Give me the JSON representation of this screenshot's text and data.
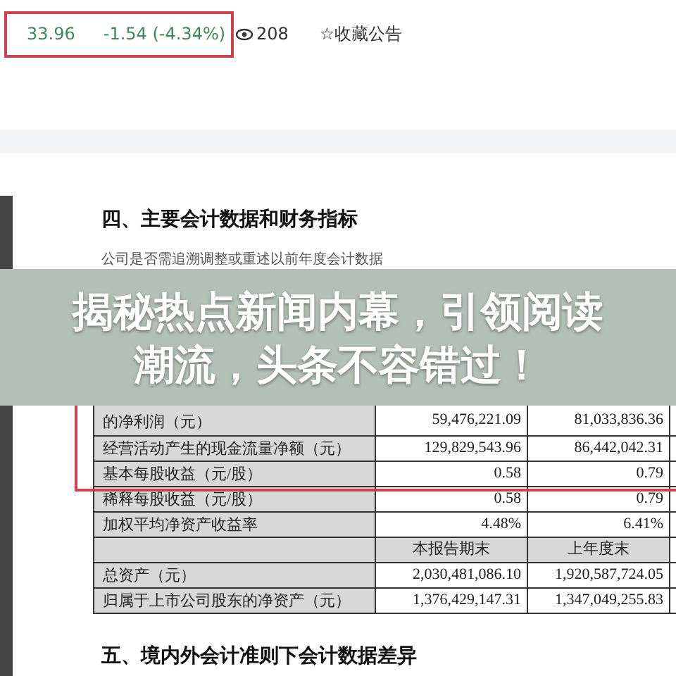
{
  "quote": {
    "price": "33.96",
    "change": "-1.54 (-4.34%)",
    "views": "208",
    "favorite": "☆收藏公告"
  },
  "document": {
    "section_heading": "四、主要会计数据和财务指标",
    "note": "公司是否需追溯调整或重述以前年度会计数据",
    "rows": [
      {
        "label": "的净利润（元）",
        "values": [
          "59,476,221.09",
          "81,033,836.36"
        ]
      },
      {
        "label": "经营活动产生的现金流量净额（元）",
        "values": [
          "129,829,543.96",
          "86,442,042.31"
        ]
      },
      {
        "label": "基本每股收益（元/股）",
        "values": [
          "0.58",
          "0.79"
        ]
      },
      {
        "label": "稀释每股收益（元/股）",
        "values": [
          "0.58",
          "0.79"
        ]
      },
      {
        "label": "加权平均净资产收益率",
        "values": [
          "4.48%",
          "6.41%"
        ]
      }
    ],
    "table_header_2": [
      "本报告期末",
      "上年度末"
    ],
    "rows_2": [
      {
        "label": "总资产（元）",
        "values": [
          "2,030,481,086.10",
          "1,920,587,724.05"
        ]
      },
      {
        "label": "归属于上市公司股东的净资产（元）",
        "values": [
          "1,376,429,147.31",
          "1,347,049,255.83"
        ]
      }
    ],
    "next_heading": "五、境内外会计准则下会计数据差异"
  },
  "banner": {
    "lines": [
      "揭秘热点新闻内幕，引领阅读",
      "潮流，头条不容错过！"
    ]
  }
}
